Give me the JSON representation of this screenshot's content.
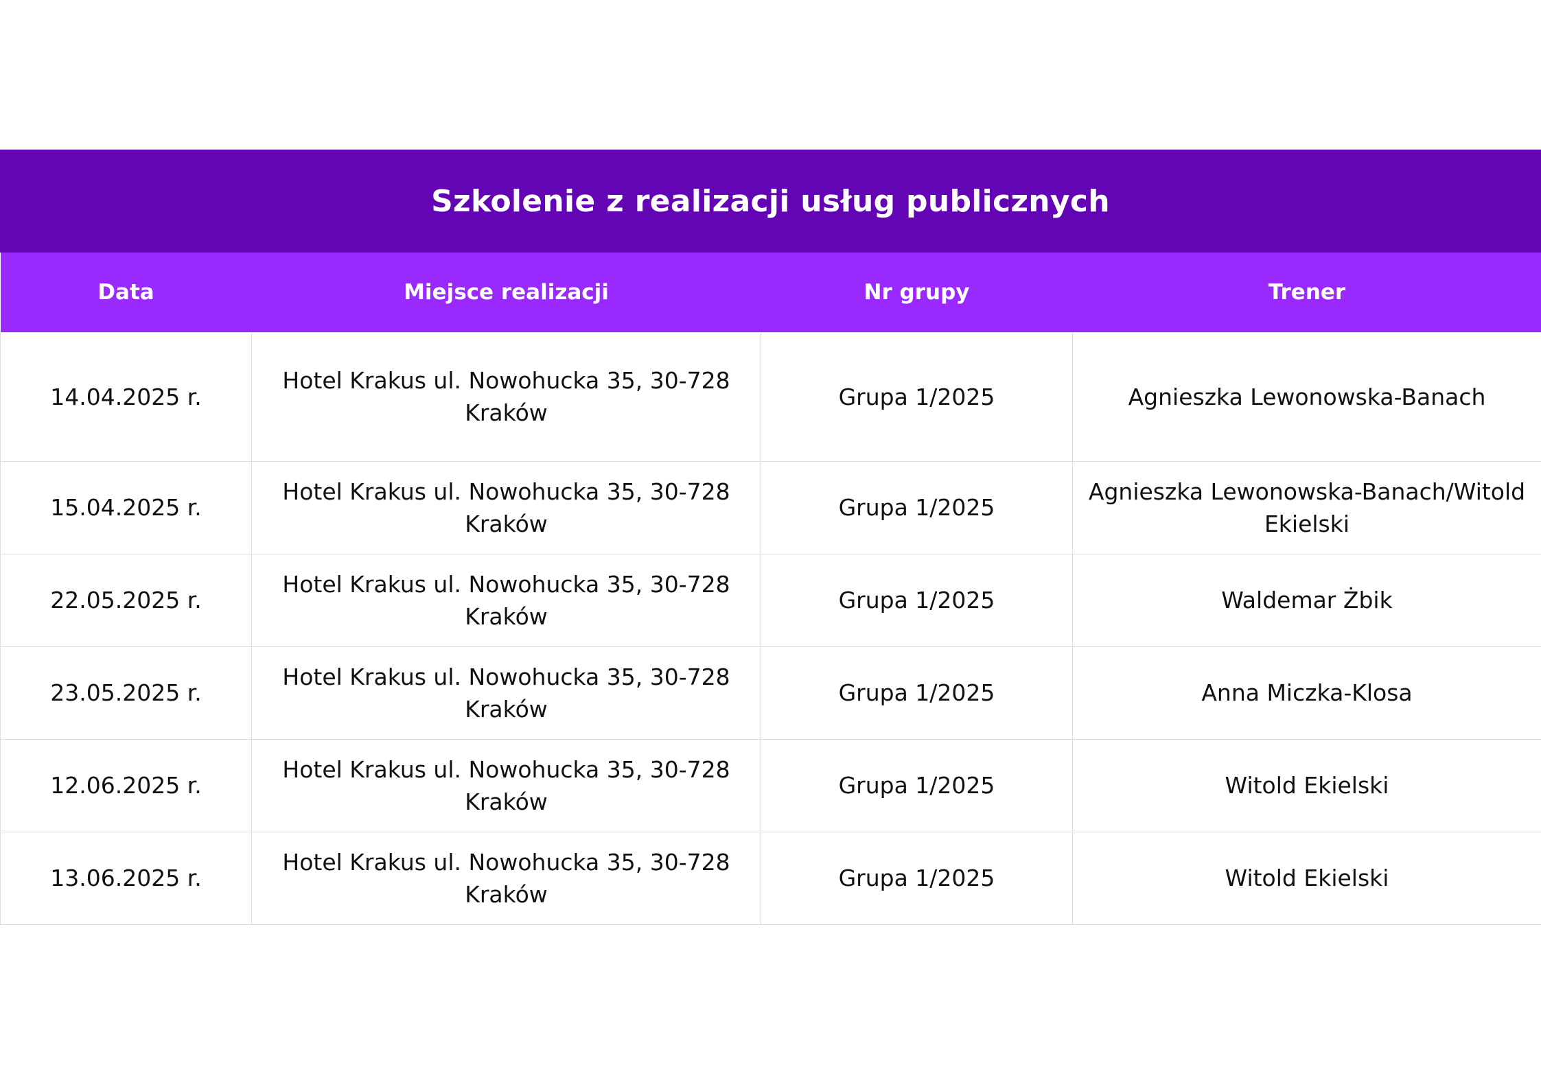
{
  "title": "Szkolenie z realizacji usług publicznych",
  "colors": {
    "title_bg": "#6305b5",
    "header_bg": "#9929fd",
    "header_text": "#ffffff",
    "cell_text": "#111111",
    "border": "#dcdcdc"
  },
  "columns": {
    "date": "Data",
    "place": "Miejsce realizacji",
    "group": "Nr grupy",
    "trainer": "Trener"
  },
  "rows": [
    {
      "date": "14.04.2025 r.",
      "place_line1": "Hotel Krakus ul. Nowohucka 35, 30-728",
      "place_line2": "Kraków",
      "group": "Grupa 1/2025",
      "trainer_line1": "Agnieszka Lewonowska-Banach",
      "trainer_line2": ""
    },
    {
      "date": "15.04.2025 r.",
      "place_line1": "Hotel Krakus ul. Nowohucka 35, 30-728",
      "place_line2": "Kraków",
      "group": "Grupa 1/2025",
      "trainer_line1": "Agnieszka Lewonowska-Banach/Witold",
      "trainer_line2": "Ekielski"
    },
    {
      "date": "22.05.2025 r.",
      "place_line1": "Hotel Krakus ul. Nowohucka 35, 30-728",
      "place_line2": "Kraków",
      "group": "Grupa 1/2025",
      "trainer_line1": "Waldemar Żbik",
      "trainer_line2": ""
    },
    {
      "date": "23.05.2025 r.",
      "place_line1": "Hotel Krakus ul. Nowohucka 35, 30-728",
      "place_line2": "Kraków",
      "group": "Grupa 1/2025",
      "trainer_line1": "Anna Miczka-Klosa",
      "trainer_line2": ""
    },
    {
      "date": "12.06.2025 r.",
      "place_line1": "Hotel Krakus ul. Nowohucka 35, 30-728",
      "place_line2": "Kraków",
      "group": "Grupa 1/2025",
      "trainer_line1": "Witold Ekielski",
      "trainer_line2": ""
    },
    {
      "date": "13.06.2025 r.",
      "place_line1": "Hotel Krakus ul. Nowohucka 35, 30-728",
      "place_line2": "Kraków",
      "group": "Grupa 1/2025",
      "trainer_line1": "Witold Ekielski",
      "trainer_line2": ""
    }
  ]
}
